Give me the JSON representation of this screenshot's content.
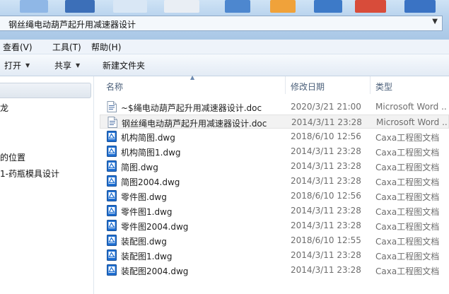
{
  "window": {
    "address": "钢丝绳电动葫芦起升用减速器设计"
  },
  "menu": {
    "items": [
      "查看(V)",
      "工具(T)",
      "帮助(H)"
    ]
  },
  "toolbar": {
    "open_label": "打开",
    "share_label": "共享",
    "new_folder_label": "新建文件夹"
  },
  "nav": {
    "items": [
      "",
      "龙",
      "的位置",
      "1-药瓶模具设计"
    ]
  },
  "columns": {
    "name": "名称",
    "date": "修改日期",
    "type": "类型"
  },
  "files": [
    {
      "name": "~$绳电动葫芦起升用减速器设计.doc",
      "date": "2020/3/21 21:00",
      "type": "Microsoft Word ..",
      "icon": "word-doc-icon"
    },
    {
      "name": "钢丝绳电动葫芦起升用减速器设计.doc",
      "date": "2014/3/11 23:28",
      "type": "Microsoft Word ..",
      "icon": "word-doc-icon"
    },
    {
      "name": "机构简图.dwg",
      "date": "2018/6/10 12:56",
      "type": "Caxa工程图文档",
      "icon": "dwg-file-icon"
    },
    {
      "name": "机构简图1.dwg",
      "date": "2014/3/11 23:28",
      "type": "Caxa工程图文档",
      "icon": "dwg-file-icon"
    },
    {
      "name": "简图.dwg",
      "date": "2014/3/11 23:28",
      "type": "Caxa工程图文档",
      "icon": "dwg-file-icon"
    },
    {
      "name": "简图2004.dwg",
      "date": "2014/3/11 23:28",
      "type": "Caxa工程图文档",
      "icon": "dwg-file-icon"
    },
    {
      "name": "零件图.dwg",
      "date": "2018/6/10 12:56",
      "type": "Caxa工程图文档",
      "icon": "dwg-file-icon"
    },
    {
      "name": "零件图1.dwg",
      "date": "2014/3/11 23:28",
      "type": "Caxa工程图文档",
      "icon": "dwg-file-icon"
    },
    {
      "name": "零件图2004.dwg",
      "date": "2014/3/11 23:28",
      "type": "Caxa工程图文档",
      "icon": "dwg-file-icon"
    },
    {
      "name": "装配图.dwg",
      "date": "2018/6/10 12:55",
      "type": "Caxa工程图文档",
      "icon": "dwg-file-icon"
    },
    {
      "name": "装配图1.dwg",
      "date": "2014/3/11 23:28",
      "type": "Caxa工程图文档",
      "icon": "dwg-file-icon"
    },
    {
      "name": "装配图2004.dwg",
      "date": "2014/3/11 23:28",
      "type": "Caxa工程图文档",
      "icon": "dwg-file-icon"
    }
  ],
  "selected_index": 1,
  "colors": {
    "accent": "#1a5fb4",
    "selection": "#f2f2f2",
    "dwg_icon": "#1f6fd1"
  }
}
